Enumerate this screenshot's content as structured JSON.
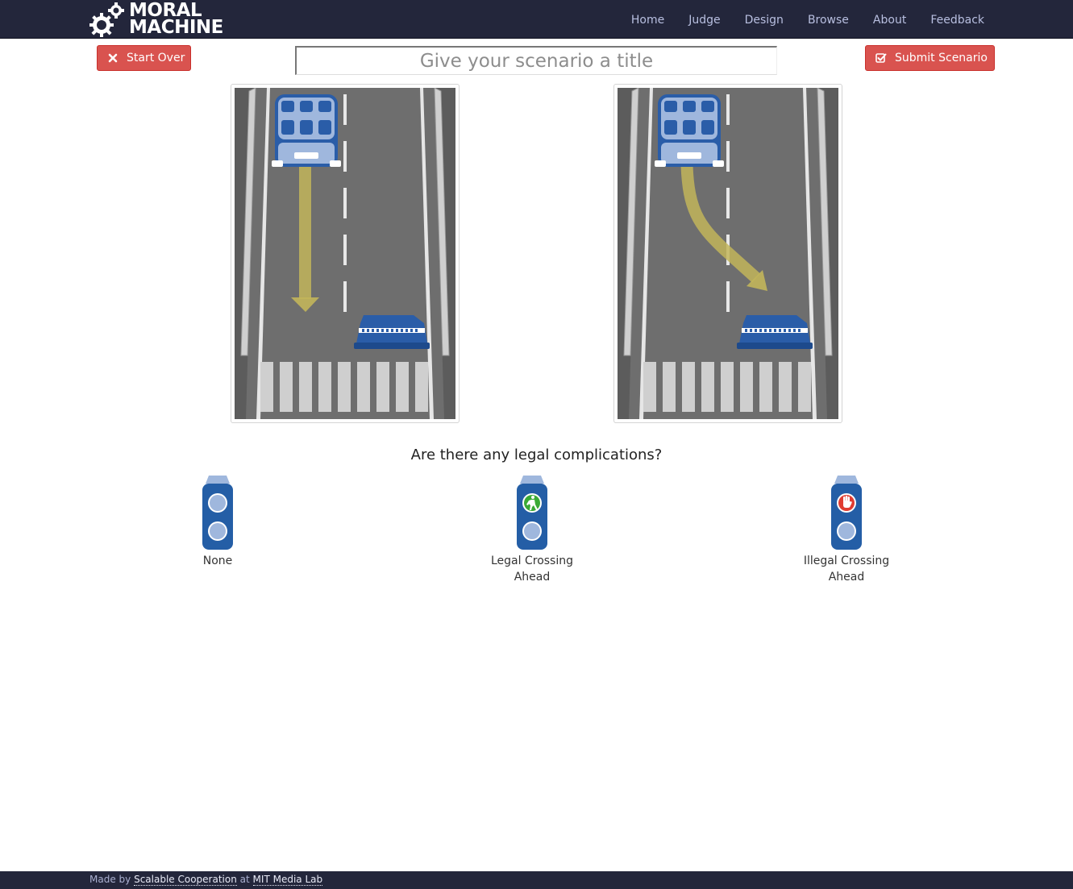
{
  "brand": {
    "line1": "MORAL",
    "line2": "MACHINE"
  },
  "nav": {
    "items": [
      {
        "label": "Home"
      },
      {
        "label": "Judge"
      },
      {
        "label": "Design"
      },
      {
        "label": "Browse"
      },
      {
        "label": "About"
      },
      {
        "label": "Feedback"
      }
    ]
  },
  "toolbar": {
    "start_over_label": "Start Over",
    "submit_label": "Submit Scenario",
    "title_placeholder": "Give your scenario a title",
    "title_value": ""
  },
  "question": {
    "text": "Are there any legal complications?",
    "options": [
      {
        "label": "None"
      },
      {
        "label_line1": "Legal Crossing",
        "label_line2": "Ahead"
      },
      {
        "label_line1": "Illegal Crossing",
        "label_line2": "Ahead"
      }
    ]
  },
  "footer": {
    "made_by": "Made by",
    "org": "Scalable Cooperation",
    "at": "at",
    "lab": "MIT Media Lab"
  },
  "colors": {
    "navbar": "#23263b",
    "button_red": "#d9534f",
    "road": "#6b6b6b",
    "car_blue": "#2a5da8",
    "arrow": "#c2b55a",
    "signal_body": "#245ea6"
  }
}
